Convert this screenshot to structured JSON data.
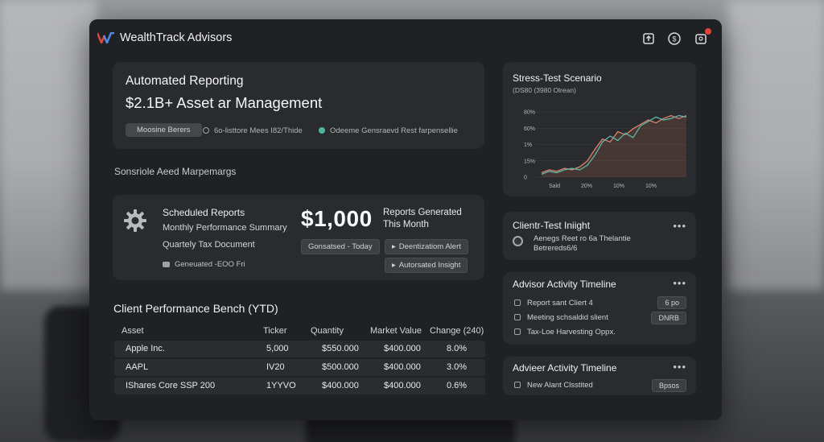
{
  "app": {
    "title": "WealthTrack Advisors"
  },
  "topbar_icons": [
    "export-icon",
    "dollar-icon",
    "notifications-icon"
  ],
  "hero": {
    "title": "Automated Reporting",
    "subtitle": "$2.1B+ Asset ar Management",
    "pill": "Moosine Berers",
    "meta1": "6o-listtore Mees I82/Thide",
    "meta2": "Odeeme Gensraevd Rest farpensellie"
  },
  "section_label": "Sonsriole Aeed Marpemargs",
  "scheduled": {
    "title": "Scheduled Reports",
    "items": [
      "Monthly Performance Summary",
      "Quartely Tax Document"
    ],
    "footer": "Geneuated -EOO Fri",
    "value": "$1,000",
    "generated_label": "Reports Generated This Month",
    "chip_generated": "Gonsatsed - Today",
    "chip_alert": "Deentizatiom Alert",
    "chip_insight": "Autorsated Insight"
  },
  "table": {
    "title": "Client Performance Bench (YTD)",
    "headers": [
      "Asset",
      "Ticker",
      "Quantity",
      "Market Value",
      "Change (240)"
    ],
    "rows": [
      [
        "Apple Inc.",
        "5,000",
        "$550.000",
        "$400.000",
        "8.0%"
      ],
      [
        "AAPL",
        "IV20",
        "$500.000",
        "$400.000",
        "3.0%"
      ],
      [
        "IShares Core SSP 200",
        "1YYVO",
        "$400.000",
        "$400.000",
        "0.6%"
      ]
    ]
  },
  "stress": {
    "title": "Stress-Test Scenario",
    "subtitle": "(DS80 (3980 Olrean)",
    "y_ticks": [
      "80%",
      "60%",
      "1%",
      "15%",
      "0"
    ],
    "x_ticks": [
      "Sald",
      "20%",
      "10%",
      "10%"
    ]
  },
  "chart_data": {
    "type": "line",
    "title": "Stress-Test Scenario",
    "subtitle": "(DS80 (3980 Olrean)",
    "y_tick_labels": [
      "80%",
      "60%",
      "1%",
      "15%",
      "0"
    ],
    "x_tick_labels": [
      "Sald",
      "20%",
      "10%",
      "10%"
    ],
    "series": [
      {
        "color": "#d9826c",
        "values": [
          6,
          10,
          8,
          12,
          10,
          14,
          22,
          38,
          52,
          48,
          62,
          58,
          66,
          72,
          78,
          74,
          80,
          84,
          80,
          84
        ]
      },
      {
        "color": "#5fb3a6",
        "values": [
          4,
          8,
          6,
          10,
          12,
          10,
          16,
          30,
          48,
          56,
          50,
          60,
          54,
          70,
          76,
          82,
          78,
          80,
          84,
          82
        ]
      }
    ],
    "ylim": [
      0,
      100
    ],
    "grid": true
  },
  "insight": {
    "title": "Clientr-Test Iniight",
    "line1": "Aenegs Reet ro 6a Thelantie",
    "line2": "Betrereds6/6"
  },
  "timeline1": {
    "title": "Advisor Activity Timeline",
    "items": [
      "Report sant Cliert 4",
      "Meeting schsaldid slient",
      "Tax-Loe Harvesting Oppx."
    ],
    "tags": [
      "6  po",
      "DNRB"
    ]
  },
  "timeline2": {
    "title": "Advieer Activity Timeline",
    "items": [
      "New Alant Clsstited"
    ],
    "tags": [
      "Bpsos"
    ]
  }
}
